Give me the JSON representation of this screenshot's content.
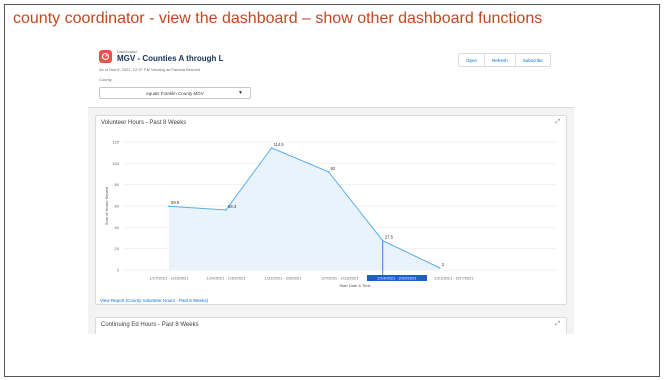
{
  "slide": {
    "title": "county coordinator - view the dashboard – show other dashboard functions"
  },
  "dashboard": {
    "type_label": "Dashboard",
    "name": "MGV - Counties A through L",
    "meta": "As of Mar 8, 2021, 12:37 PM Viewing as Pamela Bennett",
    "filter_label": "County",
    "filter_value": "equals Franklin County MGV",
    "buttons": [
      "Open",
      "Refresh",
      "Subscribe"
    ]
  },
  "card1": {
    "title": "Volunteer Hours - Past 8 Weeks",
    "footer_link": "View Report (County Volunteer Hours - Past 8 Weeks)"
  },
  "card2": {
    "title": "Continuing Ed Hours - Past 8 Weeks"
  },
  "icons": {
    "logo": "dashboard-icon",
    "expand": "expand-icon",
    "dropdown": "chevron-down-icon"
  },
  "colors": {
    "title": "#c4471f",
    "line": "#5aaee8",
    "area": "#e8f3fc",
    "highlight": "#1b5fca"
  },
  "chart_data": {
    "type": "area",
    "xlabel": "Start Date & Time",
    "ylabel": "Sum of Hours Served",
    "ylim": [
      0,
      120
    ],
    "yticks": [
      0,
      20,
      40,
      60,
      80,
      100,
      120
    ],
    "grid": true,
    "categories": [
      "1/17/2021 - 1/23/2021",
      "1/24/2021 - 1/30/2021",
      "1/31/2021 - 2/6/2021",
      "2/7/2021 - 2/13/2021",
      "2/14/2021 - 2/20/2021",
      "2/21/2021 - 2/27/2021"
    ],
    "highlighted_tick": "2/14/2021 - 2/20/2021",
    "points": [
      {
        "x": 0.0,
        "y": 59.8,
        "label": "59.8"
      },
      {
        "x": 1.0,
        "y": 56.3,
        "label": "56.3"
      },
      {
        "x": 1.8,
        "y": 114.5,
        "label": "114.5"
      },
      {
        "x": 2.8,
        "y": 92,
        "label": "92"
      },
      {
        "x": 3.75,
        "y": 27.5,
        "label": "27.5"
      },
      {
        "x": 4.75,
        "y": 2,
        "label": "2"
      }
    ]
  }
}
